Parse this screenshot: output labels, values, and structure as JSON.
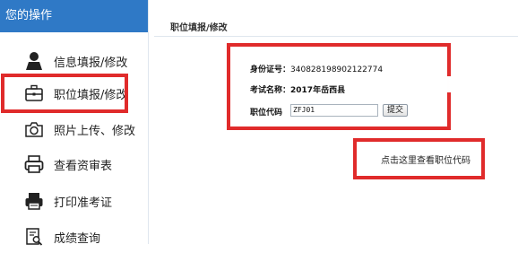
{
  "sidebar": {
    "header": "您的操作",
    "items": [
      {
        "label": "信息填报/修改",
        "icon": "user-icon"
      },
      {
        "label": "职位填报/修改",
        "icon": "briefcase-icon"
      },
      {
        "label": "照片上传、修改",
        "icon": "camera-icon"
      },
      {
        "label": "查看资审表",
        "icon": "printer-icon"
      },
      {
        "label": "打印准考证",
        "icon": "print-icon"
      },
      {
        "label": "成绩查询",
        "icon": "search-doc-icon"
      }
    ]
  },
  "main": {
    "title": "职位填报/修改",
    "id_label": "身份证号：",
    "id_value": "340828198902122774",
    "exam_label": "考试名称：",
    "exam_value": "2017年岳西县",
    "code_label": "职位代码",
    "code_value": "ZFJ01",
    "submit_label": "提交",
    "lookup_link": "点击这里查看职位代码"
  },
  "colors": {
    "accent": "#2f79c6",
    "highlight": "#e02b2b"
  }
}
